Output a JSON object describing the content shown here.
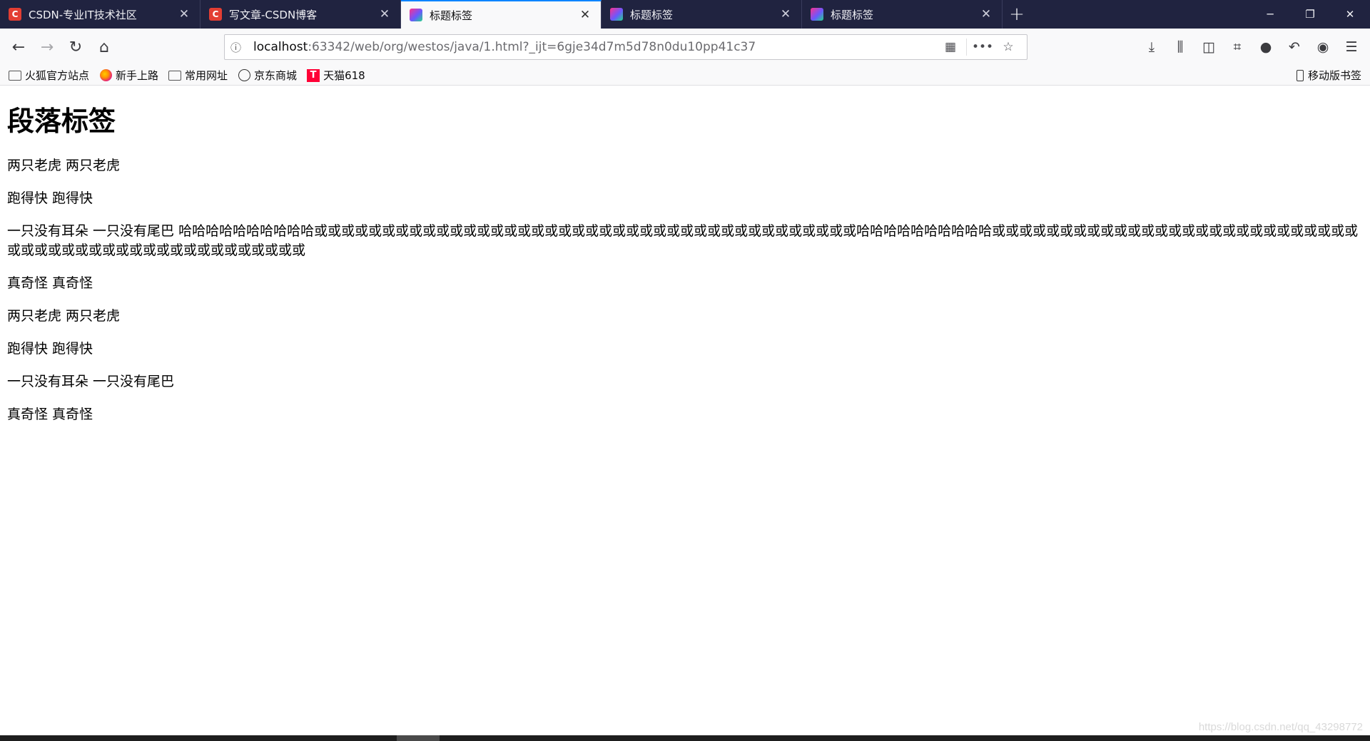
{
  "tabs": [
    {
      "title": "CSDN-专业IT技术社区",
      "icon": "csdn-logo-icon",
      "active": false
    },
    {
      "title": "写文章-CSDN博客",
      "icon": "csdn-logo-icon",
      "active": false
    },
    {
      "title": "标题标签",
      "icon": "intellij-icon",
      "active": true
    },
    {
      "title": "标题标签",
      "icon": "intellij-icon",
      "active": false
    },
    {
      "title": "标题标签",
      "icon": "intellij-icon",
      "active": false
    }
  ],
  "url": {
    "host": "localhost",
    "rest": ":63342/web/org/westos/java/1.html?_ijt=6gje34d7m5d78n0du10pp41c37"
  },
  "bookmarks": [
    {
      "label": "火狐官方站点",
      "icon": "folder-icon"
    },
    {
      "label": "新手上路",
      "icon": "firefox-icon"
    },
    {
      "label": "常用网址",
      "icon": "folder-icon"
    },
    {
      "label": "京东商城",
      "icon": "globe-icon"
    },
    {
      "label": "天猫618",
      "icon": "tmall-icon"
    }
  ],
  "mobile_bookmarks": "移动版书签",
  "page": {
    "heading": "段落标签",
    "paragraphs": [
      "两只老虎 两只老虎",
      "跑得快 跑得快",
      "一只没有耳朵 一只没有尾巴 哈哈哈哈哈哈哈哈哈哈或或或或或或或或或或或或或或或或或或或或或或或或或或或或或或或或或或或或或或或或哈哈哈哈哈哈哈哈哈哈或或或或或或或或或或或或或或或或或或或或或或或或或或或或或或或或或或或或或或或或或或或或或或或或或",
      "真奇怪 真奇怪",
      "两只老虎 两只老虎",
      "跑得快 跑得快",
      "一只没有耳朵 一只没有尾巴",
      "真奇怪 真奇怪"
    ]
  },
  "watermark": "https://blog.csdn.net/qq_43298772",
  "colors": {
    "tabbar": "#202340",
    "accent": "#0a84ff",
    "toolbar": "#f9f9fa"
  }
}
